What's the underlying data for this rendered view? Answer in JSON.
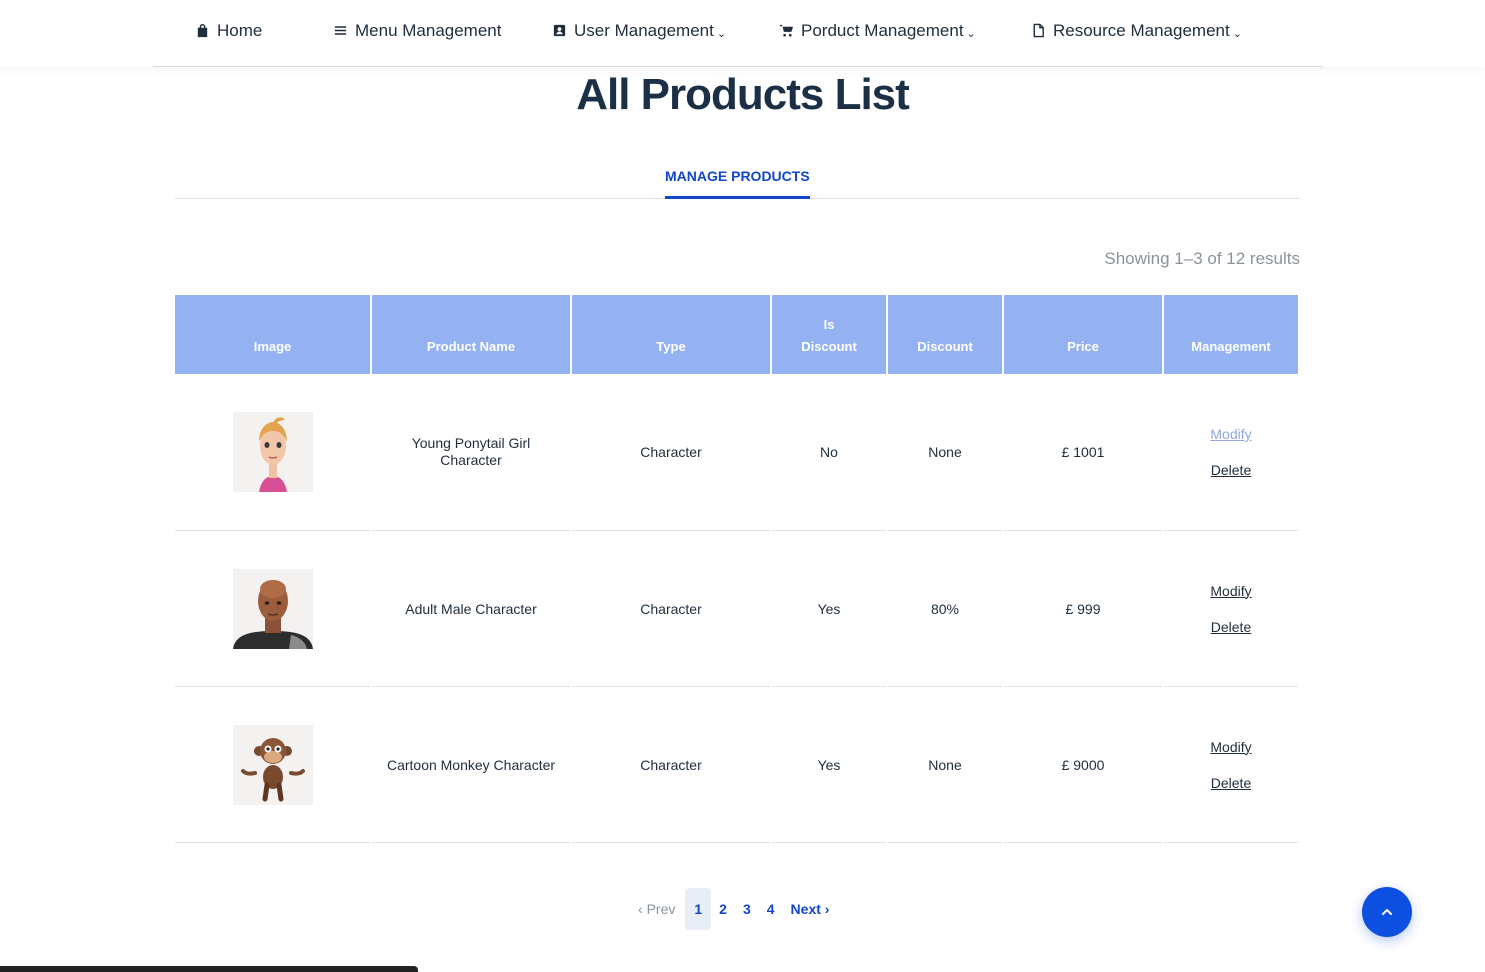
{
  "nav": {
    "items": [
      {
        "label": "Home",
        "icon": "bag-icon"
      },
      {
        "label": "Menu Management",
        "icon": "menu-icon"
      },
      {
        "label": "User Management",
        "icon": "user-card-icon"
      },
      {
        "label": "Porduct Management",
        "icon": "cart-icon"
      },
      {
        "label": "Resource Management",
        "icon": "document-icon"
      }
    ]
  },
  "page_title": "All Products List",
  "tabs": {
    "active": "MANAGE PRODUCTS"
  },
  "results_text": "Showing 1–3 of 12 results",
  "table": {
    "headers": [
      "Image",
      "Product Name",
      "Type",
      "Is",
      "Discount",
      "Discount",
      "Price",
      "Management"
    ],
    "rows": [
      {
        "name": "Young Ponytail Girl Character",
        "type": "Character",
        "is_discount": "No",
        "discount": "None",
        "price": "£ 1001",
        "modify": "Modify",
        "delete": "Delete",
        "image": "girl-character-thumbnail"
      },
      {
        "name": "Adult Male Character",
        "type": "Character",
        "is_discount": "Yes",
        "discount": "80%",
        "price": "£ 999",
        "modify": "Modify",
        "delete": "Delete",
        "image": "male-character-thumbnail"
      },
      {
        "name": "Cartoon Monkey Character",
        "type": "Character",
        "is_discount": "Yes",
        "discount": "None",
        "price": "£ 9000",
        "modify": "Modify",
        "delete": "Delete",
        "image": "monkey-character-thumbnail"
      }
    ]
  },
  "pagination": {
    "prev": "Prev",
    "pages": [
      "1",
      "2",
      "3",
      "4"
    ],
    "current": "1",
    "next": "Next"
  },
  "colors": {
    "accent": "#1246c9",
    "header_bg": "#94b2f2",
    "title": "#1b3046",
    "to_top": "#0d4fe0"
  }
}
